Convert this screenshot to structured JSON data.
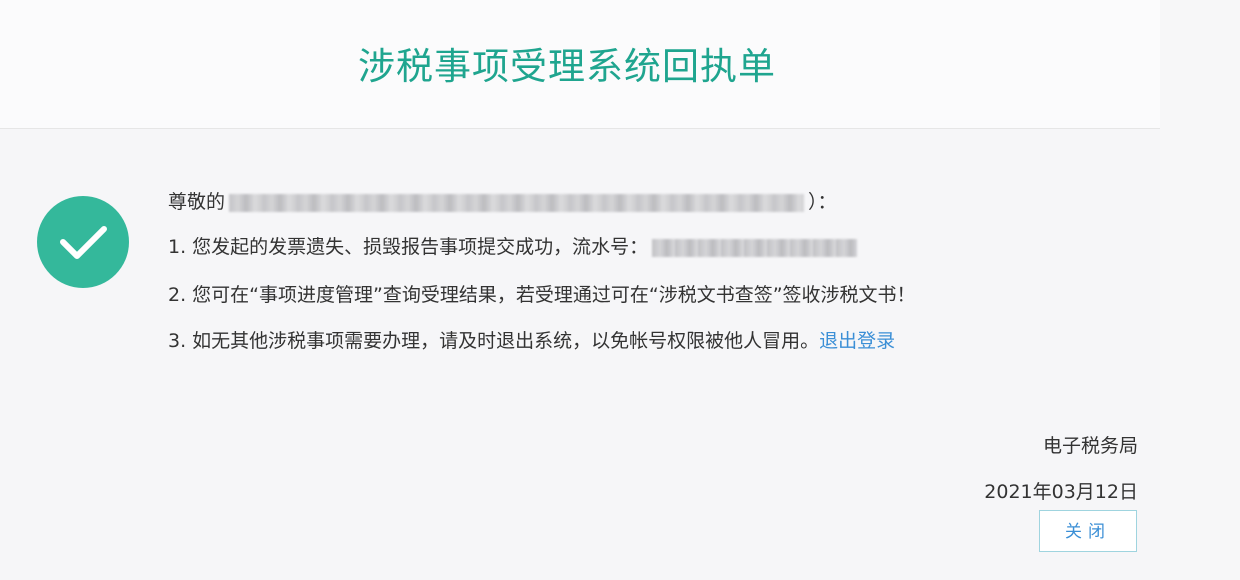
{
  "header": {
    "title": "涉税事项受理系统回执单"
  },
  "receipt": {
    "greeting_prefix": "尊敬的",
    "greeting_suffix": "）：",
    "line1": "1. 您发起的发票遗失、损毁报告事项提交成功，流水号：",
    "line2": "2. 您可在“事项进度管理”查询受理结果，若受理通过可在“涉税文书查签”签收涉税文书！",
    "line3": "3. 如无其他涉税事项需要办理，请及时退出系统，以免帐号权限被他人冒用。",
    "logout_link": "退出登录"
  },
  "footer": {
    "office": "电子税务局",
    "date": "2021年03月12日",
    "close_label": "关闭"
  },
  "colors": {
    "title": "#1fa58f",
    "check_circle": "#34b89b",
    "link": "#3b8fd6"
  }
}
